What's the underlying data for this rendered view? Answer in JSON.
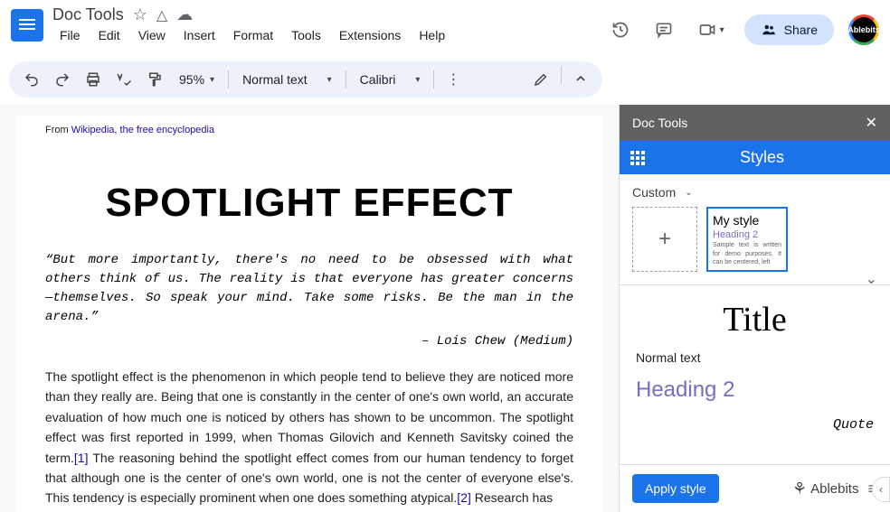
{
  "header": {
    "doc_title": "Doc Tools",
    "menu": [
      "File",
      "Edit",
      "View",
      "Insert",
      "Format",
      "Tools",
      "Extensions",
      "Help"
    ],
    "share_label": "Share",
    "avatar_text": "Ablebits"
  },
  "toolbar": {
    "zoom": "95%",
    "style": "Normal text",
    "font": "Calibri"
  },
  "document": {
    "wiki_prefix": "From ",
    "wiki_linked": "Wikipedia, the free encyclopedia",
    "heading": "SPOTLIGHT EFFECT",
    "quote": "“But more importantly, there's no need to be obsessed with what others think of us. The reality is that everyone has greater concerns—themselves. So speak your mind. Take some risks. Be the man in the arena.”",
    "attribution": "– Lois Chew (Medium)",
    "body_1": "The spotlight effect is the phenomenon in which people tend to believe they are noticed more than they really are. Being that one is constantly in the center of one's own world, an accurate evaluation of how much one is noticed by others has shown to be uncommon. The spotlight effect was first reported in 1999, when Thomas Gilovich and Kenneth Savitsky coined the term.",
    "cite_1": "[1]",
    "body_2": " The reasoning behind the spotlight effect comes from our human tendency to forget that although one is the center of one's own world, one is not the center of everyone else's. This tendency is especially prominent when one does something atypical.",
    "cite_2": "[2]",
    "body_3": " Research has"
  },
  "sidebar": {
    "panel_title": "Doc Tools",
    "styles_label": "Styles",
    "custom_label": "Custom",
    "card": {
      "title": "My style",
      "heading": "Heading 2",
      "sample": "Sample text is written for demo purposes. It can be centered, left"
    },
    "preview": {
      "title": "Title",
      "normal": "Normal text",
      "heading2": "Heading 2",
      "quote": "Quote"
    },
    "apply_label": "Apply style",
    "brand": "Ablebits"
  }
}
